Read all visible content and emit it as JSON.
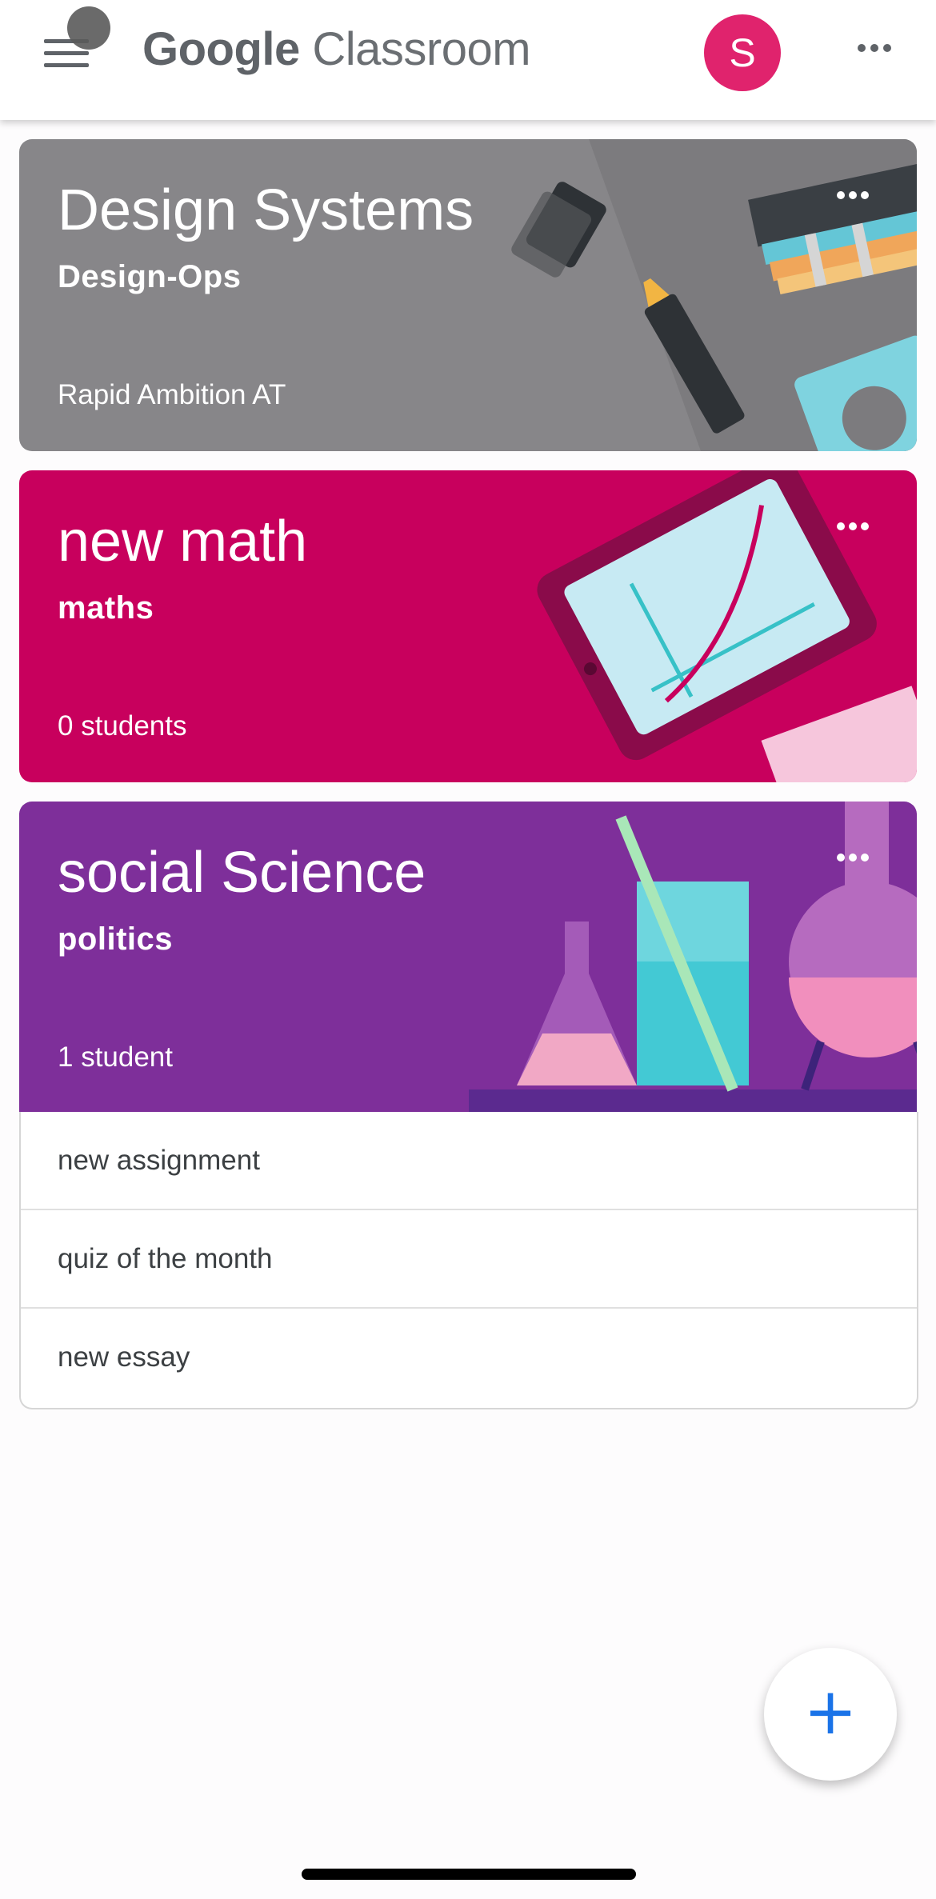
{
  "header": {
    "brand_google": "Google",
    "brand_classroom": "Classroom",
    "avatar_letter": "S",
    "icons": {
      "menu": "hamburger-menu-icon",
      "more": "more-horiz-icon"
    }
  },
  "classes": [
    {
      "title": "Design Systems",
      "section": "Design-Ops",
      "meta": "Rapid Ambition AT",
      "color": "#878689"
    },
    {
      "title": "new math",
      "section": "maths",
      "meta": "0 students",
      "color": "#c8005d"
    },
    {
      "title": "social Science",
      "section": "politics",
      "meta": "1 student",
      "color": "#7e2f9a"
    }
  ],
  "assignments": [
    "new assignment",
    "quiz of the month",
    "new essay"
  ],
  "fab": {
    "label": "+",
    "icon": "add-icon"
  },
  "colors": {
    "avatar": "#e0236d",
    "fab_plus": "#1a73e8"
  }
}
